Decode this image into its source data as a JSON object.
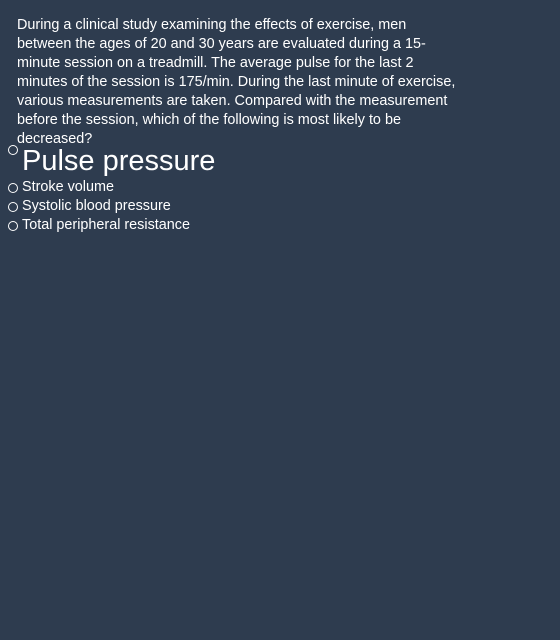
{
  "question": {
    "text": "During a clinical study examining the effects of exercise, men between the ages of 20 and 30 years are evaluated during a 15- minute session on a treadmill. The average pulse for the last 2 minutes of the session is 175/min. During the last minute of exercise, various measurements are taken. Compared with the measurement before the session, which of the following is most likely to be decreased?"
  },
  "options": [
    {
      "label": "Pulse pressure",
      "selected": false
    },
    {
      "label": "Stroke volume",
      "selected": false
    },
    {
      "label": "Systolic blood pressure",
      "selected": false
    },
    {
      "label": "Total peripheral resistance",
      "selected": false
    }
  ]
}
